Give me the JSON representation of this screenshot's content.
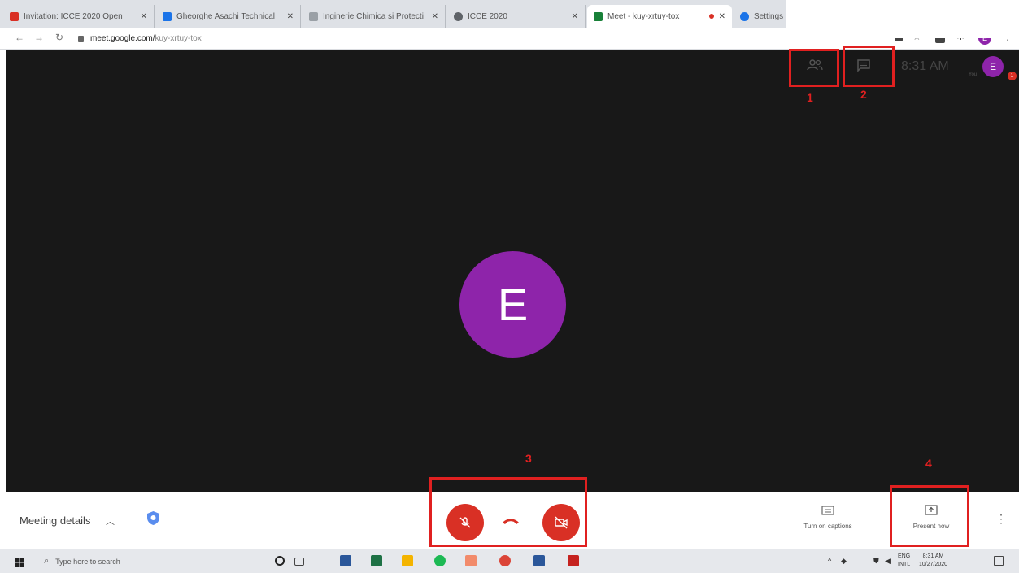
{
  "browser": {
    "tabs": [
      {
        "label": "Invitation: ICCE 2020 Open",
        "color": "#d93025"
      },
      {
        "label": "Gheorghe Asachi Technical",
        "color": "#1a73e8"
      },
      {
        "label": "Inginerie Chimica si Protecti",
        "color": "#9aa0a6"
      },
      {
        "label": "ICCE 2020",
        "color": "#5f6368"
      },
      {
        "label": "Meet - kuy-xrtuy-tox",
        "color": "#188038"
      },
      {
        "label": "Settings - Site Settings",
        "color": "#1a73e8"
      }
    ],
    "url_host": "meet.google.com/",
    "url_path": "kuy-xrtuy-tox",
    "profile_initial": "E"
  },
  "meet": {
    "time": "8:31 AM",
    "you_label": "You",
    "self_initial": "E",
    "notification_count": "1",
    "participant_initial": "E",
    "meeting_details_label": "Meeting details",
    "captions_label": "Turn on captions",
    "present_label": "Present now"
  },
  "annotations": [
    "1",
    "2",
    "3",
    "4"
  ],
  "taskbar": {
    "search_placeholder": "Type here to search",
    "lang_line1": "ENG",
    "lang_line2": "INTL",
    "clock_time": "8:31 AM",
    "clock_date": "10/27/2020"
  },
  "colors": {
    "meet_red": "#d93025",
    "avatar_purple": "#8e24aa",
    "annotation_red": "#e02020",
    "stage_bg": "#181818"
  }
}
